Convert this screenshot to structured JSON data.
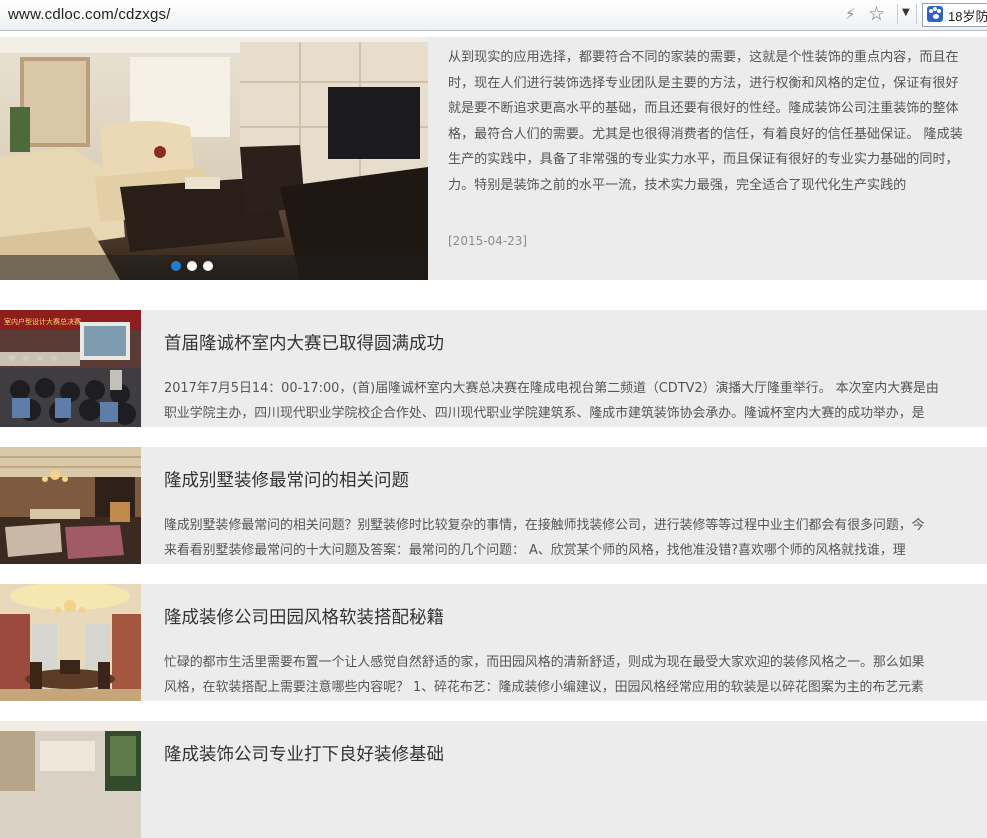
{
  "browser": {
    "url": "www.cdloc.com/cdzxgs/",
    "bolt_icon": "lightning-icon",
    "star_icon": "star-icon",
    "dropdown_icon": "chevron-down-icon",
    "extension_label": "18岁防"
  },
  "featured": {
    "text_lines": [
      "从到现实的应用选择，都要符合不同的家装的需要，这就是个性装饰的重点内容，而且在",
      "时，现在人们进行装饰选择专业团队是主要的方法，进行权衡和风格的定位，保证有很好",
      "就是要不断追求更高水平的基础，而且还要有很好的性经。隆成装饰公司注重装饰的整体",
      "格，最符合人们的需要。尤其是也很得消费者的信任，有着良好的信任基础保证。 隆成装",
      "生产的实践中，具备了非常强的专业实力水平，而且保证有很好的专业实力基础的同时，",
      "力。特别是装饰之前的水平一流，技术实力最强，完全适合了现代化生产实践的"
    ],
    "date": "[2015-04-23]",
    "slider_dots": 3,
    "active_dot": 0
  },
  "news": [
    {
      "title": "首届隆诚杯室内大赛已取得圆满成功",
      "line1": "2017年7月5日14：00-17:00，(首)届隆诚杯室内大赛总决赛在隆成电视台第二频道（CDTV2）演播大厅隆重举行。 本次室内大赛是由",
      "line2": "职业学院主办，四川现代职业学院校企合作处、四川现代职业学院建筑系、隆成市建筑装饰协会承办。隆诚杯室内大赛的成功举办，是",
      "banner_text": "室内户型设计大赛总决赛"
    },
    {
      "title": "隆成别墅装修最常问的相关问题",
      "line1": "隆成别墅装修最常问的相关问题？别墅装修时比较复杂的事情，在接触师找装修公司，进行装修等等过程中业主们都会有很多问题，今",
      "line2": "来看看别墅装修最常问的十大问题及答案：最常问的几个问题： A、欣赏某个师的风格，找他准没错?喜欢哪个师的风格就找谁，理"
    },
    {
      "title": "隆成装修公司田园风格软装搭配秘籍",
      "line1": "忙碌的都市生活里需要布置一个让人感觉自然舒适的家，而田园风格的清新舒适，则成为现在最受大家欢迎的装修风格之一。那么如果",
      "line2": "风格，在软装搭配上需要注意哪些内容呢？ 1、碎花布艺：隆成装修小编建议，田园风格经常应用的软装是以碎花图案为主的布艺元素"
    },
    {
      "title": "隆成装饰公司专业打下良好装修基础",
      "line1": "",
      "line2": ""
    }
  ]
}
